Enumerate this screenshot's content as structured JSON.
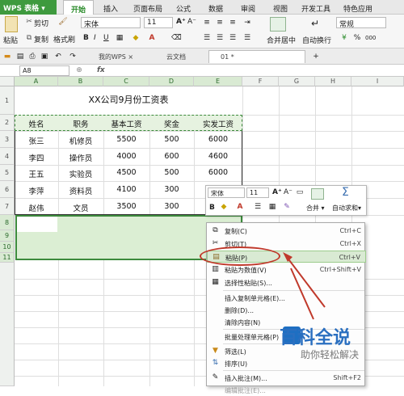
{
  "menubar": {
    "app_title": "WPS 表格",
    "tabs": [
      "开始",
      "插入",
      "页面布局",
      "公式",
      "数据",
      "审阅",
      "视图",
      "开发工具",
      "特色应用"
    ]
  },
  "ribbon": {
    "paste_label": "粘贴",
    "cut_label": "剪切",
    "copy_label": "复制",
    "format_painter_label": "格式刷",
    "font_name": "宋体",
    "font_size": "11",
    "bold": "B",
    "italic": "I",
    "underline": "U",
    "merge_label": "合并居中",
    "wrap_label": "自动换行",
    "number_format": "常规"
  },
  "doc_tabs": {
    "my_wps": "我的WPS",
    "cloud": "云文档",
    "current": "01 *"
  },
  "formula_bar": {
    "cell_ref": "A8",
    "fx": "fx",
    "content": ""
  },
  "sheet": {
    "columns": [
      "A",
      "B",
      "C",
      "D",
      "E",
      "F",
      "G",
      "H",
      "I"
    ],
    "rows": [
      "1",
      "2",
      "3",
      "4",
      "5",
      "6",
      "7",
      "8",
      "9",
      "10",
      "11"
    ],
    "title": "XX公司9月份工资表",
    "headers": [
      "姓名",
      "职务",
      "基本工资",
      "奖金",
      "实发工资"
    ],
    "data": [
      [
        "张三",
        "机修员",
        "5500",
        "500",
        "6000"
      ],
      [
        "李四",
        "操作员",
        "4000",
        "600",
        "4600"
      ],
      [
        "王五",
        "实验员",
        "4500",
        "500",
        "6000"
      ],
      [
        "李萍",
        "资料员",
        "4100",
        "300",
        ""
      ],
      [
        "赵伟",
        "文员",
        "3500",
        "300",
        ""
      ]
    ]
  },
  "minibar": {
    "font_name": "宋体",
    "font_size": "11",
    "merge_label": "合并",
    "autosum_label": "自动求和"
  },
  "context_menu": {
    "items": [
      {
        "label": "复制(C)",
        "shortcut": "Ctrl+C"
      },
      {
        "label": "剪切(T)",
        "shortcut": "Ctrl+X"
      },
      {
        "label": "粘贴(P)",
        "shortcut": "Ctrl+V"
      },
      {
        "label": "粘贴为数值(V)",
        "shortcut": "Ctrl+Shift+V"
      },
      {
        "label": "选择性粘贴(S)...",
        "shortcut": ""
      },
      {
        "label": "插入复制单元格(E)...",
        "shortcut": ""
      },
      {
        "label": "删除(D)...",
        "shortcut": ""
      },
      {
        "label": "清除内容(N)",
        "shortcut": ""
      },
      {
        "label": "批量处理单元格(P)",
        "shortcut": ""
      },
      {
        "label": "筛选(L)",
        "shortcut": ""
      },
      {
        "label": "排序(U)",
        "shortcut": ""
      },
      {
        "label": "插入批注(M)...",
        "shortcut": "Shift+F2"
      },
      {
        "label": "编辑批注(E)...",
        "shortcut": ""
      }
    ]
  },
  "watermark": {
    "title": "百科全说",
    "subtitle": "助你轻松解决"
  },
  "colors": {
    "accent": "#2a8b2a",
    "selection_fill": "#dbeed3",
    "annotation_red": "#c0392b"
  }
}
